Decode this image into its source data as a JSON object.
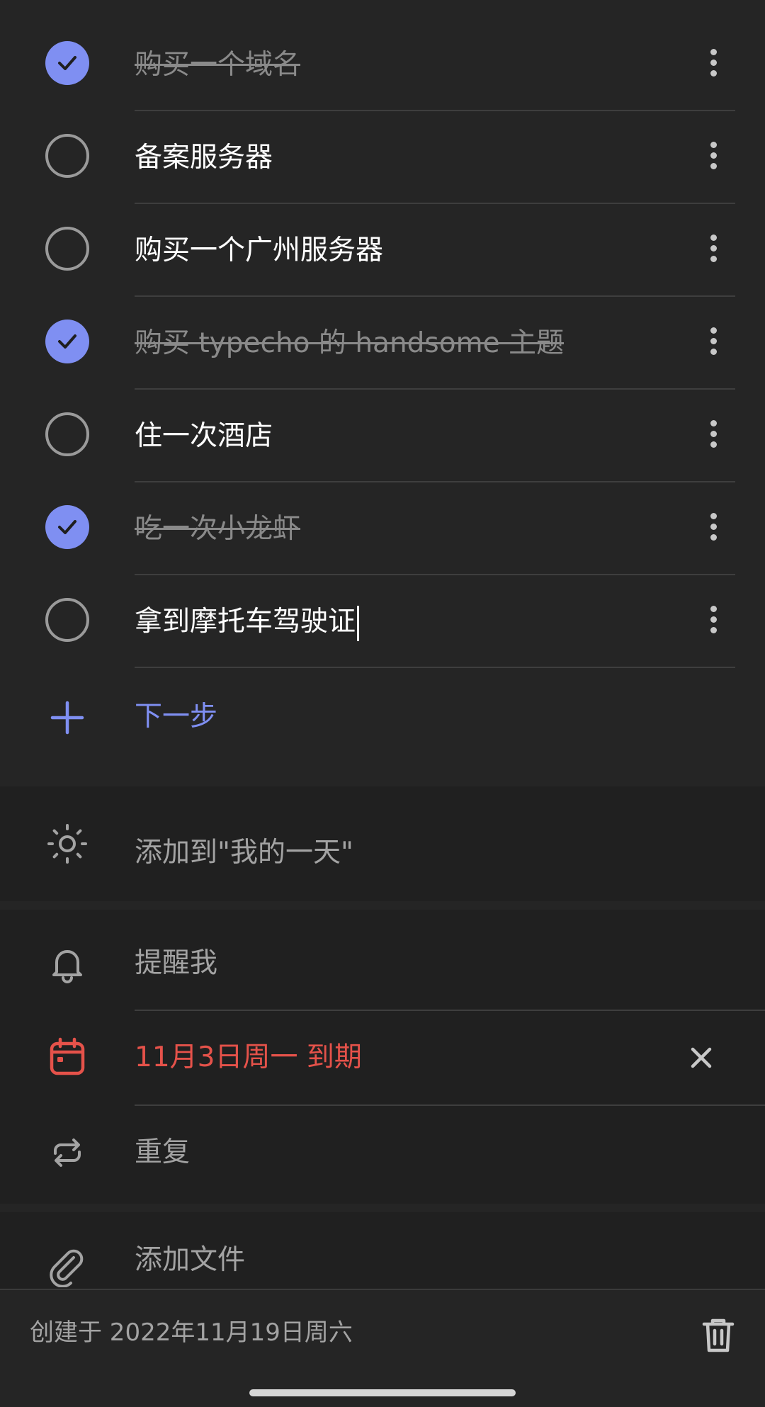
{
  "steps": [
    {
      "text": "购买一个域名",
      "done": true
    },
    {
      "text": "备案服务器",
      "done": false
    },
    {
      "text": "购买一个广州服务器",
      "done": false
    },
    {
      "text": "购买 typecho 的 handsome 主题",
      "done": true
    },
    {
      "text": "住一次酒店",
      "done": false
    },
    {
      "text": "吃一次小龙虾",
      "done": true
    },
    {
      "text": "拿到摩托车驾驶证",
      "done": false
    }
  ],
  "add_step": {
    "label": "下一步"
  },
  "options": {
    "my_day": "添加到\"我的一天\"",
    "remind": "提醒我",
    "due": "11月3日周一 到期",
    "repeat": "重复",
    "attach": "添加文件"
  },
  "footer": {
    "created": "创建于 2022年11月19日周六"
  },
  "colors": {
    "accent": "#7f8ff2",
    "due": "#e5524a",
    "background": "#252525"
  },
  "icons": [
    "check-icon",
    "more-vertical-icon",
    "plus-icon",
    "sun-icon",
    "bell-icon",
    "calendar-icon",
    "close-icon",
    "repeat-icon",
    "paperclip-icon",
    "trash-icon"
  ]
}
